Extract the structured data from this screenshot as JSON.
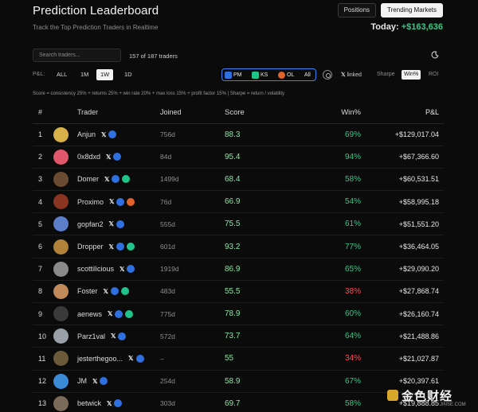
{
  "header": {
    "title": "Prediction Leaderboard",
    "subtitle": "Track the Top Prediction Traders in Realtime",
    "positions_label": "Positions",
    "trending_label": "Trending Markets",
    "today_label": "Today:",
    "today_value": "+$163,636"
  },
  "toolbar": {
    "search_placeholder": "Search traders...",
    "count_text": "157 of 187 traders",
    "theme_icon": "moon-icon"
  },
  "filters": {
    "pl_label": "P&L:",
    "ranges": [
      "ALL",
      "1M",
      "1W",
      "1D"
    ],
    "active_range": "1W",
    "platforms": [
      "PM",
      "KS",
      "OL",
      "All"
    ],
    "linked_label": "linked",
    "sort_options": [
      "Sharpe",
      "Win%",
      "ROI"
    ],
    "active_sort": "Win%"
  },
  "formula": "Score = consistency 25% + returns 25% + win rate 20% + max loss 15% + profit factor 15%   |   Sharpe = return / volatility",
  "table": {
    "headers": [
      "#",
      "Trader",
      "Joined",
      "Score",
      "Win%",
      "P&L"
    ],
    "rows": [
      {
        "rank": "1",
        "name": "Anjun",
        "joined": "756d",
        "score": "88.3",
        "win": "69%",
        "pnl": "+$129,017.04",
        "avatar_color": "#d8b04a",
        "ks": false,
        "ol": false,
        "win_color": "#3ec487"
      },
      {
        "rank": "2",
        "name": "0x8dxd",
        "joined": "84d",
        "score": "95.4",
        "win": "94%",
        "pnl": "+$67,366.60",
        "avatar_color": "#e0566a",
        "ks": false,
        "ol": false,
        "win_color": "#3ec487"
      },
      {
        "rank": "3",
        "name": "Domer",
        "joined": "1499d",
        "score": "68.4",
        "win": "58%",
        "pnl": "+$60,531.51",
        "avatar_color": "#6b4a32",
        "ks": true,
        "ol": false,
        "win_color": "#3ec487"
      },
      {
        "rank": "4",
        "name": "Proximo",
        "joined": "76d",
        "score": "66.9",
        "win": "54%",
        "pnl": "+$58,995.18",
        "avatar_color": "#8a3422",
        "ks": false,
        "ol": true,
        "win_color": "#3ec487"
      },
      {
        "rank": "5",
        "name": "gopfan2",
        "joined": "555d",
        "score": "75.5",
        "win": "61%",
        "pnl": "+$51,551.20",
        "avatar_color": "#5c7ec8",
        "ks": false,
        "ol": false,
        "win_color": "#3ec487"
      },
      {
        "rank": "6",
        "name": "Dropper",
        "joined": "601d",
        "score": "93.2",
        "win": "77%",
        "pnl": "+$36,464.05",
        "avatar_color": "#b0823a",
        "ks": true,
        "ol": false,
        "win_color": "#3ec487"
      },
      {
        "rank": "7",
        "name": "scottilicious",
        "joined": "1919d",
        "score": "86.9",
        "win": "65%",
        "pnl": "+$29,090.20",
        "avatar_color": "#8a8a8a",
        "ks": false,
        "ol": false,
        "win_color": "#3ec487"
      },
      {
        "rank": "8",
        "name": "Foster",
        "joined": "483d",
        "score": "55.5",
        "win": "38%",
        "pnl": "+$27,868.74",
        "avatar_color": "#c08a5a",
        "ks": true,
        "ol": false,
        "win_color": "#ff4d5a"
      },
      {
        "rank": "9",
        "name": "aenews",
        "joined": "775d",
        "score": "78.9",
        "win": "60%",
        "pnl": "+$26,160.74",
        "avatar_color": "#3a3a3a",
        "ks": true,
        "ol": false,
        "win_color": "#3ec487"
      },
      {
        "rank": "10",
        "name": "Parz1val",
        "joined": "572d",
        "score": "73.7",
        "win": "64%",
        "pnl": "+$21,488.86",
        "avatar_color": "#9aa0a8",
        "ks": false,
        "ol": false,
        "win_color": "#3ec487"
      },
      {
        "rank": "11",
        "name": "jesterthegoo...",
        "joined": "–",
        "score": "55",
        "win": "34%",
        "pnl": "+$21,027.87",
        "avatar_color": "#6a5a3a",
        "ks": false,
        "ol": false,
        "win_color": "#ff4d5a"
      },
      {
        "rank": "12",
        "name": "JM",
        "joined": "254d",
        "score": "58.9",
        "win": "67%",
        "pnl": "+$20,397.61",
        "avatar_color": "#3a8ad8",
        "ks": false,
        "ol": false,
        "win_color": "#3ec487"
      },
      {
        "rank": "13",
        "name": "betwick",
        "joined": "303d",
        "score": "69.7",
        "win": "58%",
        "pnl": "+$19,888.85",
        "avatar_color": "#7a6a5a",
        "ks": false,
        "ol": false,
        "win_color": "#3ec487"
      }
    ]
  },
  "watermark": {
    "text": "金色财经",
    "sub": "JINSE.COM"
  }
}
